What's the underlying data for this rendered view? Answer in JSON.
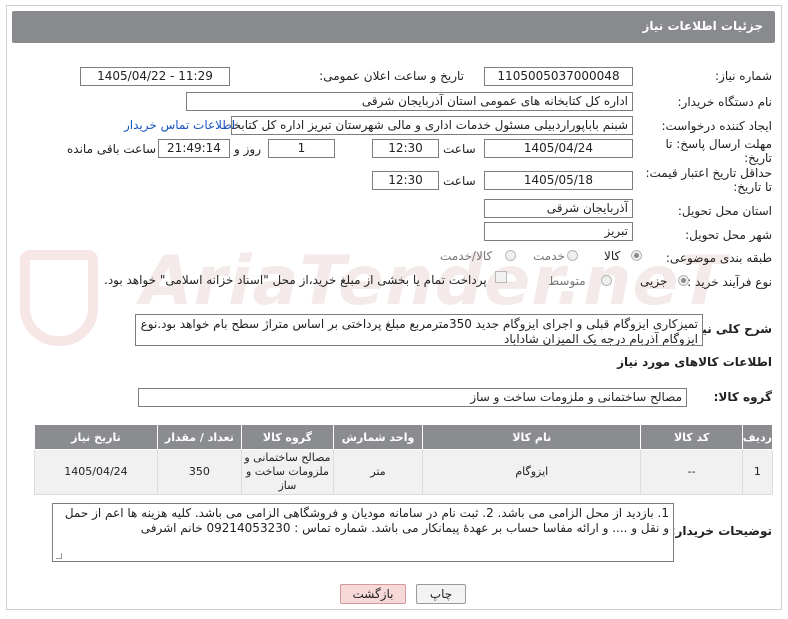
{
  "header": {
    "title": "جزئیات اطلاعات نیاز"
  },
  "watermark": "AriaTender.neT",
  "fields": {
    "need_number": {
      "label": "شماره نیاز:",
      "value": "1105005037000048"
    },
    "announce": {
      "label": "تاریخ و ساعت اعلان عمومی:",
      "value": "1405/04/22 - 11:29"
    },
    "buyer": {
      "label": "نام دستگاه خریدار:",
      "value": "اداره کل کتابخانه های عمومی استان آذربایجان شرقی"
    },
    "creator": {
      "label": "ایجاد کننده درخواست:",
      "value": "شبنم باباپوراردبیلی مسئول خدمات اداری و مالی شهرستان تبریز اداره کل کتابخانه",
      "link": "اطلاعات تماس خریدار"
    },
    "reply_deadline": {
      "label": "مهلت ارسال پاسخ: تا تاریخ:",
      "date": "1405/04/24",
      "time_label": "ساعت",
      "time": "12:30",
      "days": "1",
      "days_label": "روز و",
      "remaining": "21:49:14",
      "remaining_label": "ساعت باقی مانده"
    },
    "price_validity": {
      "label": "حداقل تاریخ اعتبار قیمت: تا تاریخ:",
      "date": "1405/05/18",
      "time_label": "ساعت",
      "time": "12:30"
    },
    "province": {
      "label": "استان محل تحویل:",
      "value": "آذربایجان شرقی"
    },
    "city": {
      "label": "شهر محل تحویل:",
      "value": "تبریز"
    },
    "category": {
      "label": "طبقه بندی موضوعی:",
      "options": [
        "کالا",
        "خدمت",
        "کالا/خدمت"
      ],
      "selected": "کالا"
    },
    "process": {
      "label": "نوع فرآیند خرید :",
      "options": [
        "جزیی",
        "متوسط"
      ],
      "selected": "جزیی",
      "note": "پرداخت تمام یا بخشی از مبلغ خرید،از محل \"اسناد خزانه اسلامی\" خواهد بود."
    }
  },
  "summary": {
    "label": "شرح کلی نیاز:",
    "text": "تمیزکاری ایزوگام قبلی و اجرای ایزوگام جدید 350مترمربع مبلغ پرداختی بر اساس متراژ سطح بام خواهد بود.نوع ایزوگام آذربام درجه یک المیزان شاداباد"
  },
  "goods": {
    "section_title": "اطلاعات کالاهای مورد نیاز",
    "group_label": "گروه کالا:",
    "group_value": "مصالح ساختمانی و ملزومات ساخت و ساز",
    "columns": [
      "ردیف",
      "کد کالا",
      "نام کالا",
      "واحد شمارش",
      "گروه کالا",
      "تعداد / مقدار",
      "تاریخ نیاز"
    ],
    "rows": [
      {
        "row": "1",
        "code": "--",
        "name": "ایزوگام",
        "unit": "متر",
        "group": "مصالح ساختمانی و ملزومات ساخت و ساز",
        "qty": "350",
        "date": "1405/04/24"
      }
    ]
  },
  "buyer_notes": {
    "label": "توضیحات خریدار:",
    "text": "1. بازدید از محل الزامی می باشد. 2. ثبت نام در سامانه مودیان و فروشگاهی الزامی می باشد. کلیه هزینه ها اعم از حمل و نقل و .... و ارائه مفاسا حساب بر عهدهٔ پیمانکار می باشد.  شماره تماس : 09214053230 خانم اشرفی"
  },
  "buttons": {
    "print": "چاپ",
    "back": "بازگشت"
  }
}
